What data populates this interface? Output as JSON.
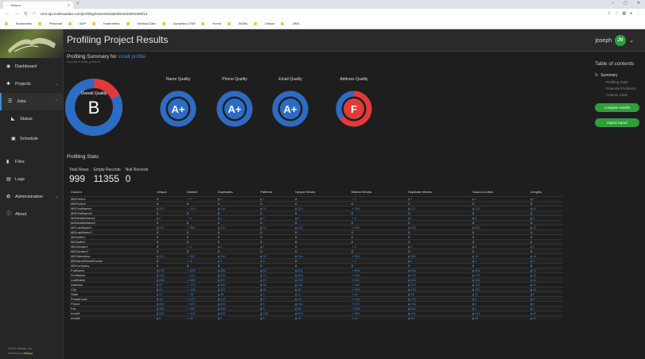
{
  "browser": {
    "tab_title": "Unison",
    "url": "cnm-api.melissadata.com/profiling/review/62a8339c0e40001060f13",
    "bookmarks": [
      "Bookmarks",
      "Personal",
      "ADP",
      "Kubernetes",
      "Melissa Data",
      "Dynamics CRM",
      "Home",
      "BDMs",
      "Unison",
      "JIRA"
    ]
  },
  "sidebar": {
    "items": [
      {
        "label": "Dashboard",
        "icon": "dashboard-icon"
      },
      {
        "label": "Projects",
        "icon": "projects-icon"
      },
      {
        "label": "Jobs",
        "icon": "jobs-icon"
      },
      {
        "label": "Status",
        "icon": "status-icon"
      },
      {
        "label": "Schedule",
        "icon": "schedule-icon"
      },
      {
        "label": "Files",
        "icon": "files-icon"
      },
      {
        "label": "Logs",
        "icon": "logs-icon"
      },
      {
        "label": "Administration",
        "icon": "administration-icon"
      },
      {
        "label": "About",
        "icon": "about-icon"
      }
    ],
    "footer_line1": "©2022 Melissa, Inc.",
    "footer_line2_prefix": "Powered by ",
    "footer_brand": "Melissa"
  },
  "header": {
    "title": "Profiling Project Results",
    "user_name": "joseph",
    "user_initials": "JV"
  },
  "summary": {
    "heading": "Profiling Summary for ",
    "profile_link": "small profile",
    "subtitle": "Input file in small_profile.txt",
    "overall_label": "Overall Quality",
    "overall_grade": "B",
    "overall_fraction": 0.82,
    "gauges": [
      {
        "label": "Name Quality",
        "grade": "A+",
        "fraction": 1.0,
        "color": "#2b6cc4"
      },
      {
        "label": "Phone Quality",
        "grade": "A+",
        "fraction": 1.0,
        "color": "#2b6cc4"
      },
      {
        "label": "Email Quality",
        "grade": "A+",
        "fraction": 1.0,
        "color": "#2b6cc4"
      },
      {
        "label": "Address Quality",
        "grade": "F",
        "fraction": 0.35,
        "color": "#e23a3a"
      }
    ]
  },
  "stats": {
    "title": "Profiling Stats",
    "total_rows_label": "Total Rows",
    "total_rows": "999",
    "empty_records_label": "Empty Records",
    "empty_records": "11355",
    "null_records_label": "Null Records",
    "null_records": "0",
    "columns": [
      "Column",
      "Unique",
      "Distinct",
      "Duplicates",
      "Patterns",
      "Unique Words",
      "Distinct Words",
      "Duplicate Words",
      "Sound-A-Likes",
      "Lengths"
    ],
    "rows": [
      [
        "MDPrefix1",
        "0",
        "1",
        "1",
        "1",
        "0",
        "1",
        "1",
        "1",
        "1"
      ],
      [
        "MDPrefix2",
        "0",
        "0",
        "0",
        "0",
        "0",
        "0",
        "0",
        "0",
        "0"
      ],
      [
        "MDFirstName1",
        "103",
        "319",
        "216",
        "32",
        "103",
        "320",
        "217",
        "215",
        "51"
      ],
      [
        "MDFirstName2",
        "0",
        "0",
        "0",
        "0",
        "0",
        "0",
        "0",
        "0",
        "0"
      ],
      [
        "MDMiddleName1",
        "2",
        "4",
        "2",
        "3",
        "2",
        "4",
        "2",
        "5",
        "3"
      ],
      [
        "MDMiddleName2",
        "0",
        "0",
        "0",
        "0",
        "0",
        "0",
        "0",
        "0",
        "0"
      ],
      [
        "MDLastName1",
        "232",
        "582",
        "349",
        "31",
        "234",
        "589",
        "355",
        "433",
        "13"
      ],
      [
        "MDLastName2",
        "0",
        "0",
        "0",
        "0",
        "0",
        "0",
        "0",
        "0",
        "0"
      ],
      [
        "MDSuffix1",
        "0",
        "0",
        "0",
        "0",
        "0",
        "0",
        "0",
        "0",
        "0"
      ],
      [
        "MDSuffix2",
        "0",
        "0",
        "0",
        "0",
        "0",
        "0",
        "0",
        "0",
        "0"
      ],
      [
        "MDGender1",
        "0",
        "4",
        "4",
        "1",
        "0",
        "4",
        "4",
        "4",
        "1"
      ],
      [
        "MDGender2",
        "0",
        "0",
        "0",
        "0",
        "0",
        "0",
        "0",
        "0",
        "0"
      ],
      [
        "MDSalutation",
        "242",
        "592",
        "350",
        "30",
        "215",
        "595",
        "380",
        "15",
        "16"
      ],
      [
        "MDNameResultCodes",
        "0",
        "4",
        "4",
        "3",
        "0",
        "3",
        "3",
        "3",
        "3"
      ],
      [
        "MDCompany",
        "0",
        "0",
        "0",
        "0",
        "0",
        "0",
        "0",
        "0",
        "0"
      ],
      [
        "FullName",
        "274",
        "628",
        "355",
        "85",
        "332",
        "800",
        "468",
        "405",
        "17"
      ],
      [
        "FirstName",
        "103",
        "311",
        "211",
        "16",
        "105",
        "324",
        "219",
        "215",
        "10"
      ],
      [
        "LastName",
        "236",
        "583",
        "347",
        "23",
        "238",
        "592",
        "354",
        "438",
        "14"
      ],
      [
        "Address",
        "97",
        "170",
        "150",
        "88",
        "118",
        "405",
        "372",
        "131",
        "10"
      ],
      [
        "City",
        "13",
        "128",
        "115",
        "32",
        "18",
        "153",
        "135",
        "130",
        "14"
      ],
      [
        "State",
        "11",
        "39",
        "38",
        "3",
        "11",
        "39",
        "38",
        "31",
        "2"
      ],
      [
        "PostalCode",
        "15",
        "127",
        "112",
        "2",
        "15",
        "128",
        "113",
        "4",
        "5"
      ],
      [
        "Phone",
        "336",
        "672",
        "284",
        "3",
        "336",
        "672",
        "296",
        "3",
        "6"
      ],
      [
        "Fax",
        "151",
        "167",
        "168",
        "3",
        "38",
        "249",
        "311",
        "1",
        "2"
      ],
      [
        "email1",
        "283",
        "579",
        "335",
        "328",
        "329",
        "863",
        "431",
        "449",
        "30"
      ],
      [
        "email2",
        "8",
        "11",
        "3",
        "8",
        "15",
        "44",
        "38",
        "18",
        "12"
      ]
    ]
  },
  "toc": {
    "title": "Table of contents",
    "summary": "Summary",
    "subitems": [
      "Profiling Stats",
      "Potential Problems",
      "Column Stats"
    ],
    "compare_btn": "compare results",
    "export_btn": "export report"
  }
}
